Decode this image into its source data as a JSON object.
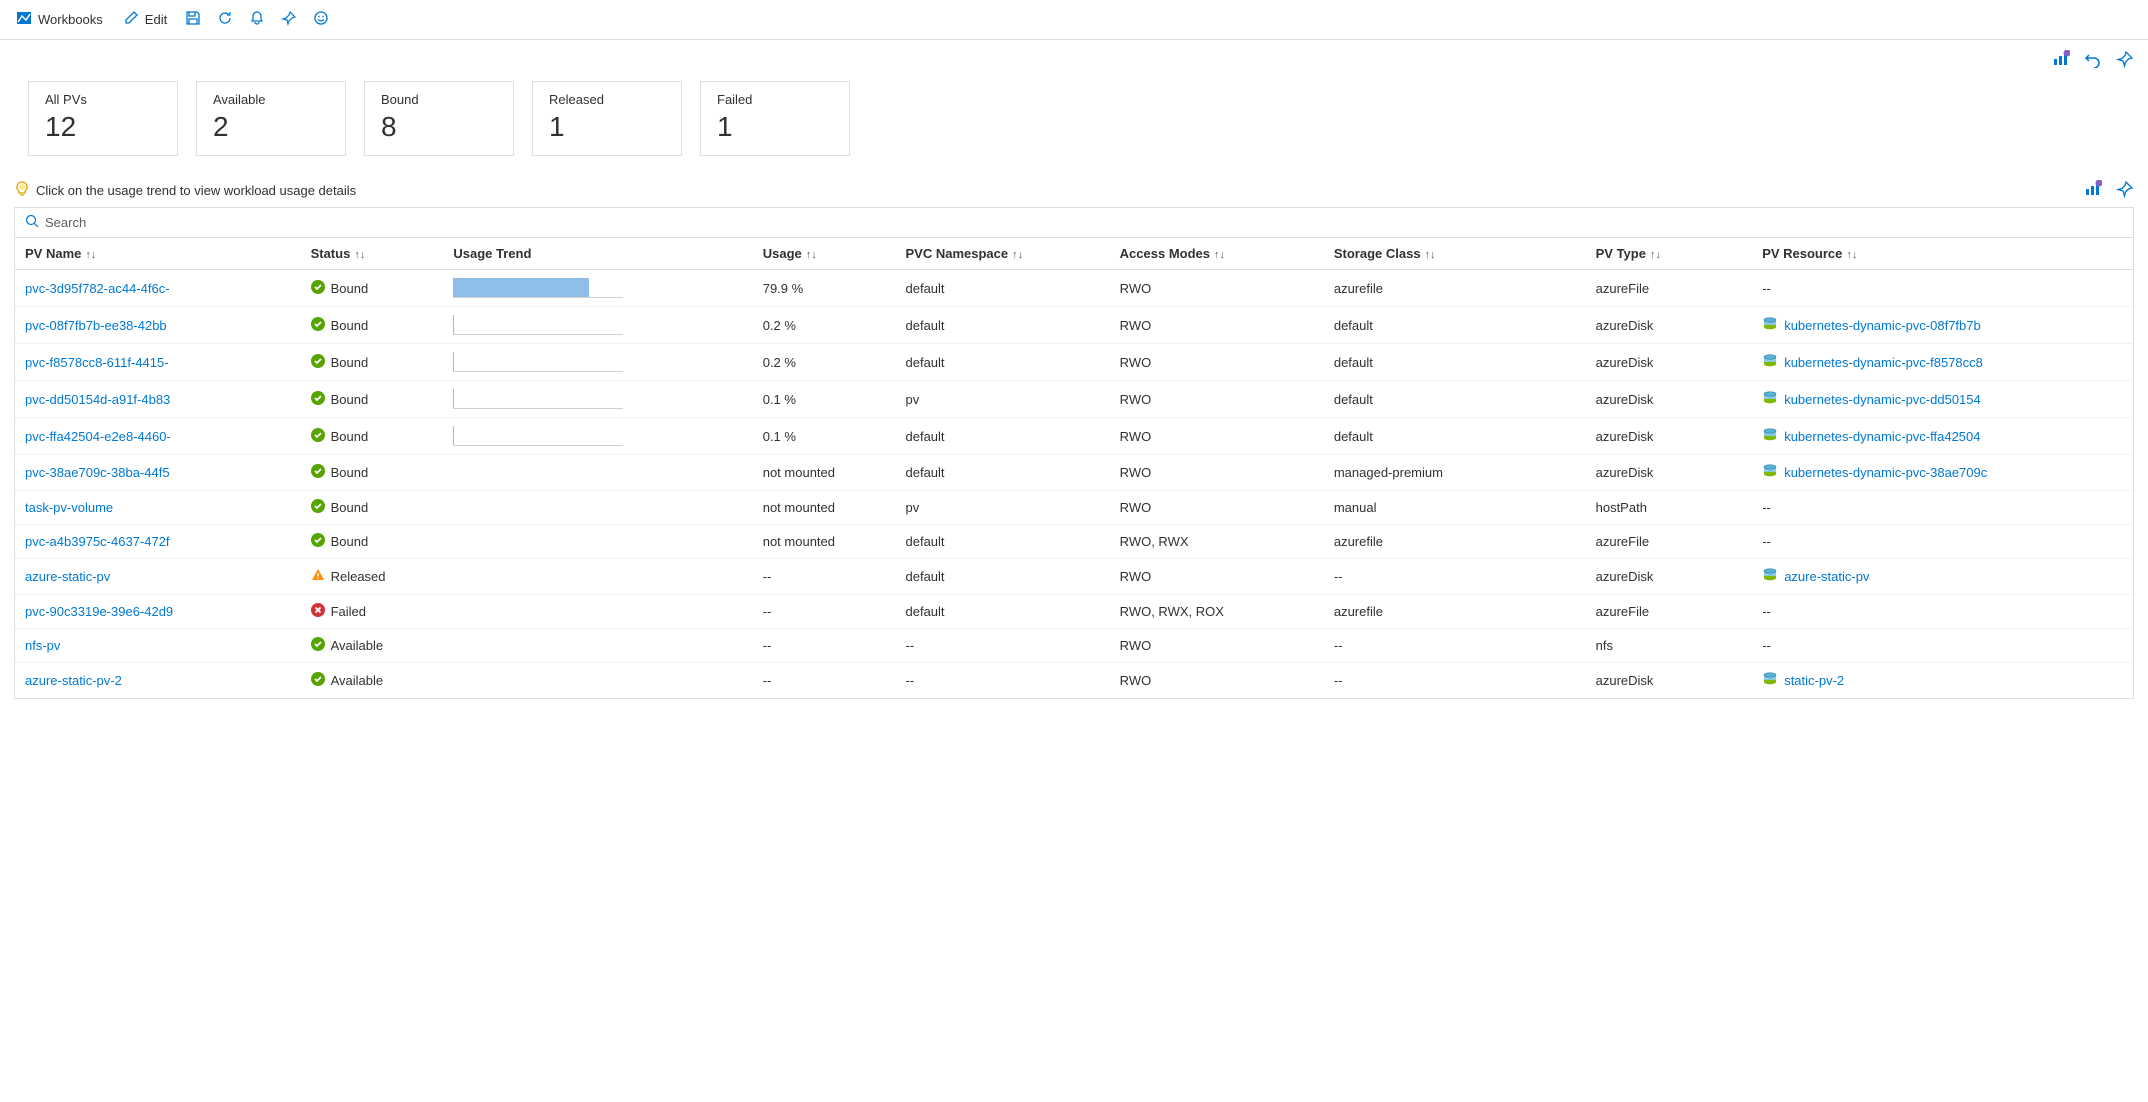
{
  "toolbar": {
    "workbooks": "Workbooks",
    "edit": "Edit"
  },
  "cards": [
    {
      "label": "All PVs",
      "value": "12"
    },
    {
      "label": "Available",
      "value": "2"
    },
    {
      "label": "Bound",
      "value": "8"
    },
    {
      "label": "Released",
      "value": "1"
    },
    {
      "label": "Failed",
      "value": "1"
    }
  ],
  "hint": "Click on the usage trend to view workload usage details",
  "search_placeholder": "Search",
  "columns": {
    "name": "PV Name",
    "status": "Status",
    "trend": "Usage Trend",
    "usage": "Usage",
    "ns": "PVC Namespace",
    "access": "Access Modes",
    "class": "Storage Class",
    "type": "PV Type",
    "res": "PV Resource"
  },
  "rows": [
    {
      "name": "pvc-3d95f782-ac44-4f6c-",
      "status": "Bound",
      "status_kind": "ok",
      "trend_pct": 80,
      "usage": "79.9 %",
      "ns": "default",
      "access": "RWO",
      "class": "azurefile",
      "type": "azureFile",
      "res": "--"
    },
    {
      "name": "pvc-08f7fb7b-ee38-42bb",
      "status": "Bound",
      "status_kind": "ok",
      "trend_pct": 0.2,
      "usage": "0.2 %",
      "ns": "default",
      "access": "RWO",
      "class": "default",
      "type": "azureDisk",
      "res": "kubernetes-dynamic-pvc-08f7fb7b"
    },
    {
      "name": "pvc-f8578cc8-611f-4415-",
      "status": "Bound",
      "status_kind": "ok",
      "trend_pct": 0.2,
      "usage": "0.2 %",
      "ns": "default",
      "access": "RWO",
      "class": "default",
      "type": "azureDisk",
      "res": "kubernetes-dynamic-pvc-f8578cc8"
    },
    {
      "name": "pvc-dd50154d-a91f-4b83",
      "status": "Bound",
      "status_kind": "ok",
      "trend_pct": 0.1,
      "usage": "0.1 %",
      "ns": "pv",
      "access": "RWO",
      "class": "default",
      "type": "azureDisk",
      "res": "kubernetes-dynamic-pvc-dd50154"
    },
    {
      "name": "pvc-ffa42504-e2e8-4460-",
      "status": "Bound",
      "status_kind": "ok",
      "trend_pct": 0.1,
      "usage": "0.1 %",
      "ns": "default",
      "access": "RWO",
      "class": "default",
      "type": "azureDisk",
      "res": "kubernetes-dynamic-pvc-ffa42504"
    },
    {
      "name": "pvc-38ae709c-38ba-44f5",
      "status": "Bound",
      "status_kind": "ok",
      "trend_pct": null,
      "usage": "not mounted",
      "ns": "default",
      "access": "RWO",
      "class": "managed-premium",
      "type": "azureDisk",
      "res": "kubernetes-dynamic-pvc-38ae709c"
    },
    {
      "name": "task-pv-volume",
      "status": "Bound",
      "status_kind": "ok",
      "trend_pct": null,
      "usage": "not mounted",
      "ns": "pv",
      "access": "RWO",
      "class": "manual",
      "type": "hostPath",
      "res": "--"
    },
    {
      "name": "pvc-a4b3975c-4637-472f",
      "status": "Bound",
      "status_kind": "ok",
      "trend_pct": null,
      "usage": "not mounted",
      "ns": "default",
      "access": "RWO, RWX",
      "class": "azurefile",
      "type": "azureFile",
      "res": "--"
    },
    {
      "name": "azure-static-pv",
      "status": "Released",
      "status_kind": "warn",
      "trend_pct": null,
      "usage": "--",
      "ns": "default",
      "access": "RWO",
      "class": "--",
      "type": "azureDisk",
      "res": "azure-static-pv"
    },
    {
      "name": "pvc-90c3319e-39e6-42d9",
      "status": "Failed",
      "status_kind": "fail",
      "trend_pct": null,
      "usage": "--",
      "ns": "default",
      "access": "RWO, RWX, ROX",
      "class": "azurefile",
      "type": "azureFile",
      "res": "--"
    },
    {
      "name": "nfs-pv",
      "status": "Available",
      "status_kind": "ok",
      "trend_pct": null,
      "usage": "--",
      "ns": "--",
      "access": "RWO",
      "class": "--",
      "type": "nfs",
      "res": "--"
    },
    {
      "name": "azure-static-pv-2",
      "status": "Available",
      "status_kind": "ok",
      "trend_pct": null,
      "usage": "--",
      "ns": "--",
      "access": "RWO",
      "class": "--",
      "type": "azureDisk",
      "res": "static-pv-2"
    }
  ]
}
